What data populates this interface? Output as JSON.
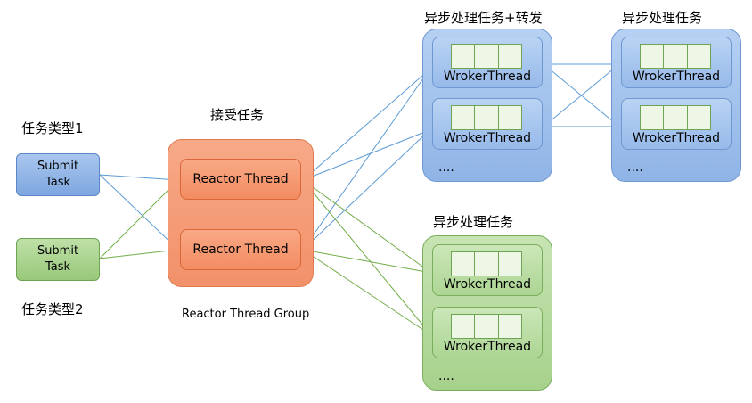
{
  "labels": {
    "task_type_1": "任务类型1",
    "task_type_2": "任务类型2",
    "accept_task": "接受任务",
    "reactor_group": "Reactor Thread Group",
    "async_forward": "异步处理任务+转发",
    "async_blue_right": "异步处理任务",
    "async_green": "异步处理任务"
  },
  "tasks": [
    {
      "label_line1": "Submit",
      "label_line2": "Task"
    },
    {
      "label_line1": "Submit",
      "label_line2": "Task"
    }
  ],
  "reactors": [
    {
      "label": "Reactor Thread"
    },
    {
      "label": "Reactor Thread"
    }
  ],
  "workers": {
    "blue_left": [
      {
        "label": "WrokerThread"
      },
      {
        "label": "WrokerThread"
      }
    ],
    "blue_right": [
      {
        "label": "WrokerThread"
      },
      {
        "label": "WrokerThread"
      }
    ],
    "green": [
      {
        "label": "WrokerThread"
      },
      {
        "label": "WrokerThread"
      }
    ]
  },
  "ellipsis": "....",
  "colors": {
    "blue_arrow": "#5b9bd5",
    "green_arrow": "#70ad47"
  }
}
